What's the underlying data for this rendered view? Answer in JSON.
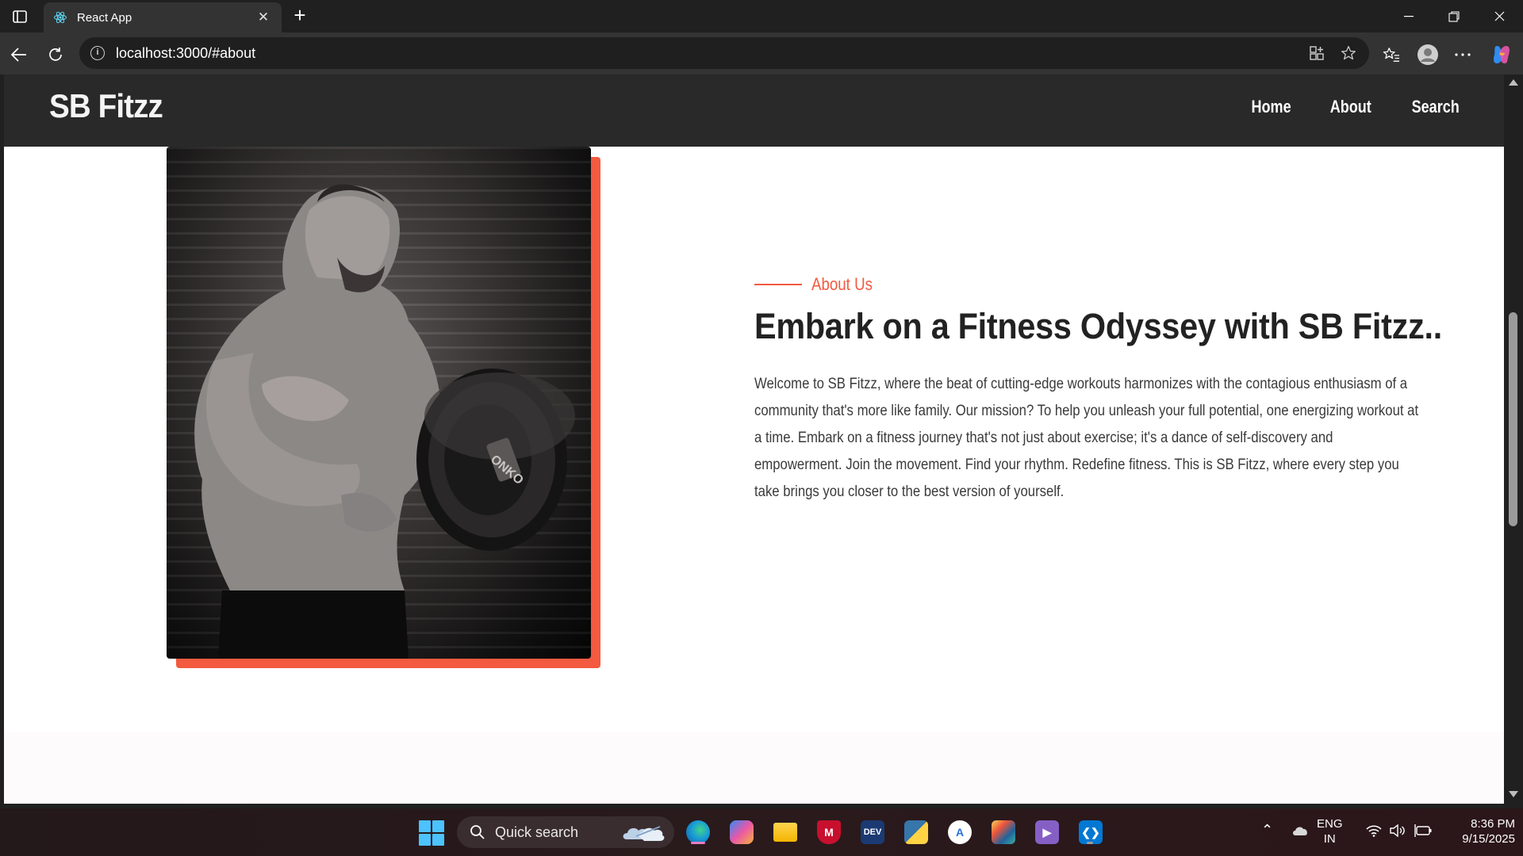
{
  "browser": {
    "tab_title": "React App",
    "url": "localhost:3000/#about"
  },
  "site": {
    "brand": "SB Fitzz",
    "nav": [
      "Home",
      "About",
      "Search"
    ]
  },
  "about": {
    "kicker": "About Us",
    "heading": "Embark on a Fitness Odyssey with SB Fitzz..",
    "body": "Welcome to SB Fitzz, where the beat of cutting-edge workouts harmonizes with the contagious enthusiasm of a community that's more like family. Our mission? To help you unleash your full potential, one energizing workout at a time. Embark on a fitness journey that's not just about exercise; it's a dance of self-discovery and empowerment. Join the movement. Find your rhythm. Redefine fitness. This is SB Fitzz, where every step you take brings you closer to the best version of yourself.",
    "accent_color": "#f35a3f"
  },
  "taskbar": {
    "search_placeholder": "Quick search",
    "language": "ENG",
    "region": "IN",
    "time": "8:36 PM",
    "date": "9/15/2025",
    "apps": [
      "edge-icon",
      "copilot-icon",
      "file-explorer-icon",
      "mcafee-icon",
      "devhome-icon",
      "python-icon",
      "app-installer-icon",
      "paint-icon",
      "visual-studio-icon",
      "vscode-icon"
    ]
  }
}
